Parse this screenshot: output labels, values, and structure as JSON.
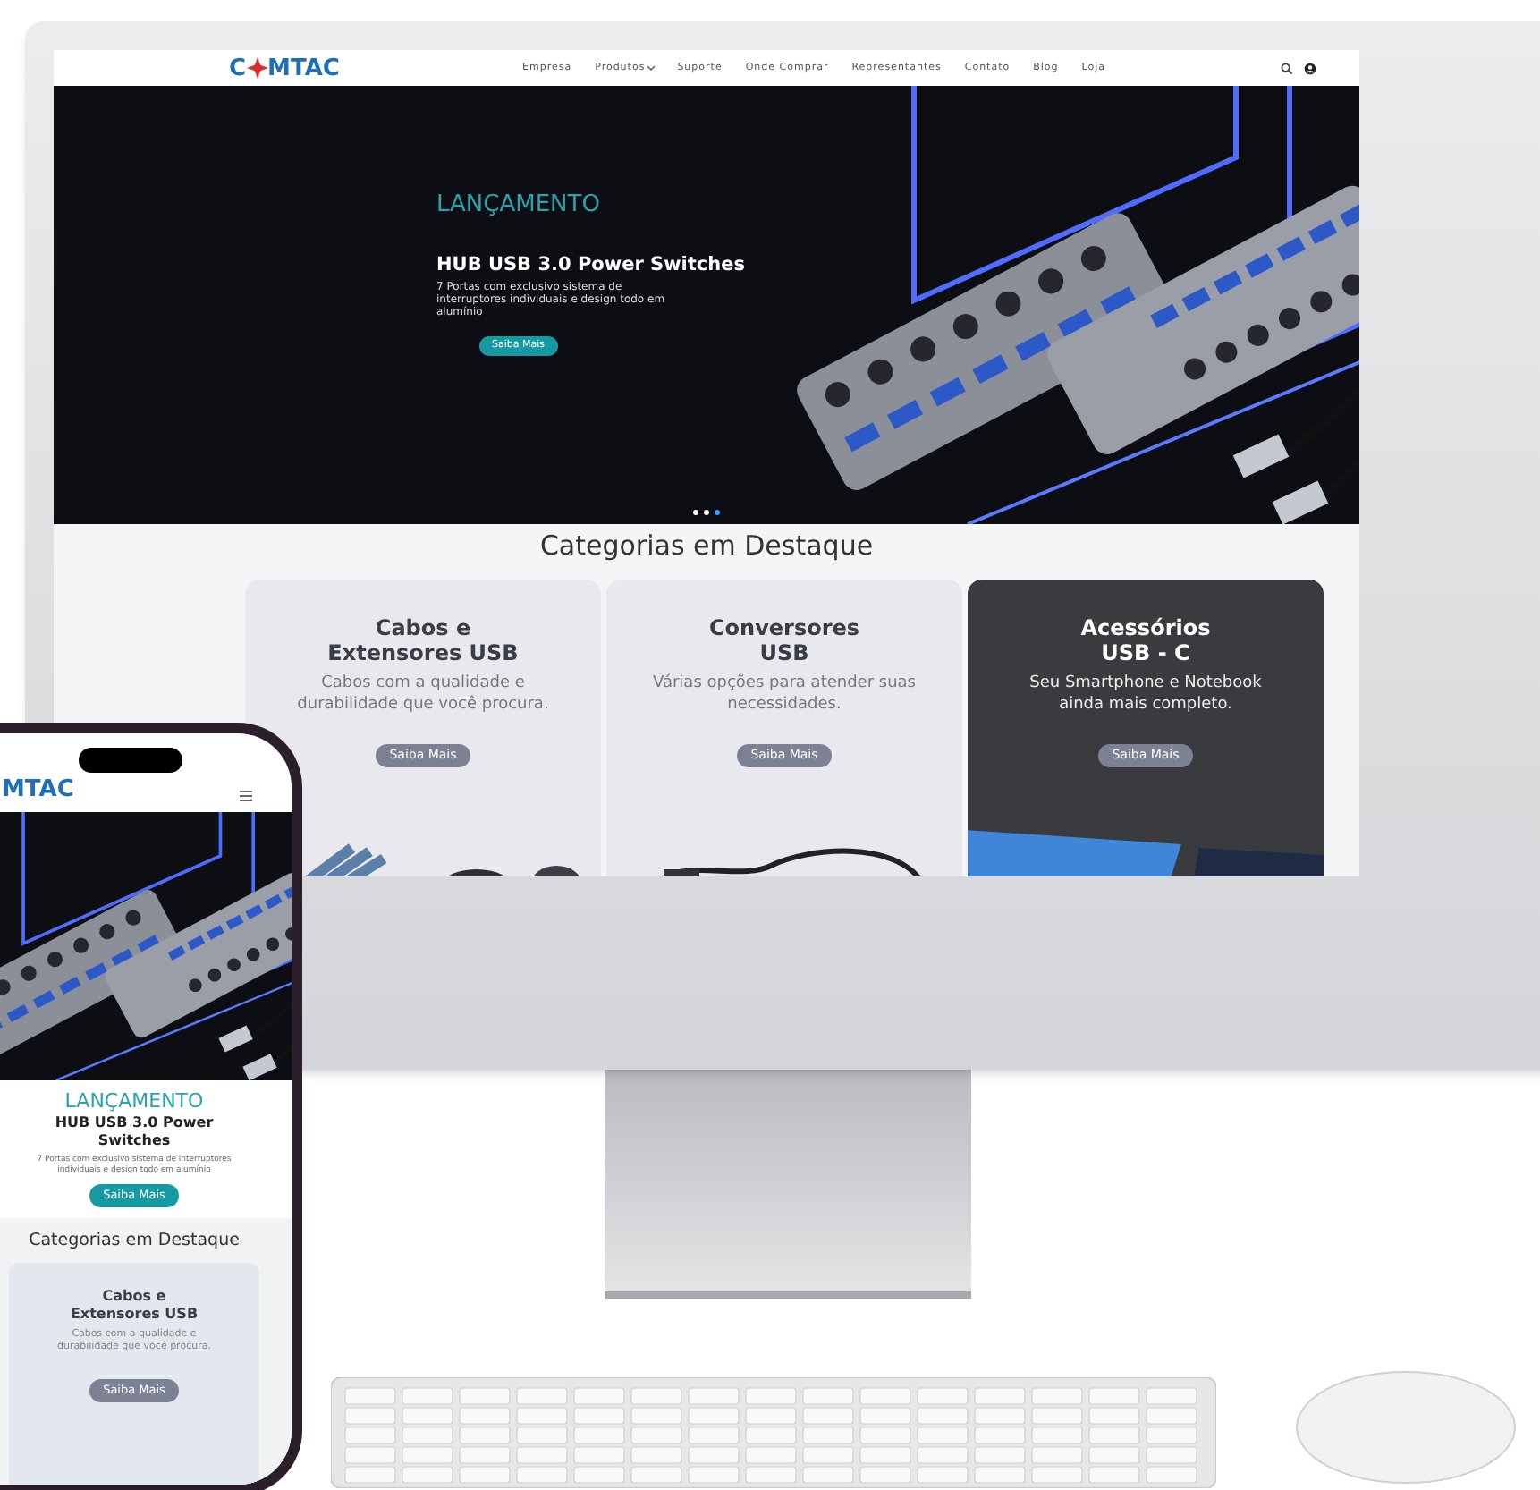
{
  "desktop": {
    "logo": {
      "start": "C",
      "end": "MTAC"
    },
    "nav": [
      {
        "label": "Empresa",
        "dropdown": false
      },
      {
        "label": "Produtos",
        "dropdown": true
      },
      {
        "label": "Suporte",
        "dropdown": false
      },
      {
        "label": "Onde Comprar",
        "dropdown": false
      },
      {
        "label": "Representantes",
        "dropdown": false
      },
      {
        "label": "Contato",
        "dropdown": false
      },
      {
        "label": "Blog",
        "dropdown": false
      },
      {
        "label": "Loja",
        "dropdown": false
      }
    ],
    "hero": {
      "eyebrow": "LANÇAMENTO",
      "title": "HUB USB 3.0 Power Switches",
      "description": "7 Portas com exclusivo sistema de interruptores individuais e design todo em alumínio",
      "button": "Saiba Mais",
      "slides": [
        {
          "selected": false
        },
        {
          "selected": false
        },
        {
          "selected": true
        }
      ]
    },
    "section_title": "Categorias em Destaque",
    "categories": [
      {
        "kind": "light",
        "title": [
          "Cabos e",
          "Extensores USB"
        ],
        "description": "Cabos com a qualidade e durabilidade que você procura.",
        "button": "Saiba Mais"
      },
      {
        "kind": "light",
        "title": [
          "Conversores",
          "USB"
        ],
        "description": "Várias opções para atender suas necessidades.",
        "button": "Saiba Mais"
      },
      {
        "kind": "dark",
        "title": [
          "Acessórios",
          "USB - C"
        ],
        "description": "Seu Smartphone e Notebook ainda mais completo.",
        "button": "Saiba Mais"
      }
    ]
  },
  "phone": {
    "logo": "MTAC",
    "hero": {
      "eyebrow": "LANÇAMENTO",
      "title": "HUB USB 3.0 Power Switches",
      "description": "7 Portas com exclusivo sistema de interruptores individuais e design todo em alumínio",
      "button": "Saiba Mais"
    },
    "section_title": "Categorias em Destaque",
    "categories": [
      {
        "kind": "light",
        "title": [
          "Cabos e",
          "Extensores USB"
        ],
        "description": "Cabos com a qualidade e durabilidade que você procura.",
        "button": "Saiba Mais"
      }
    ]
  }
}
